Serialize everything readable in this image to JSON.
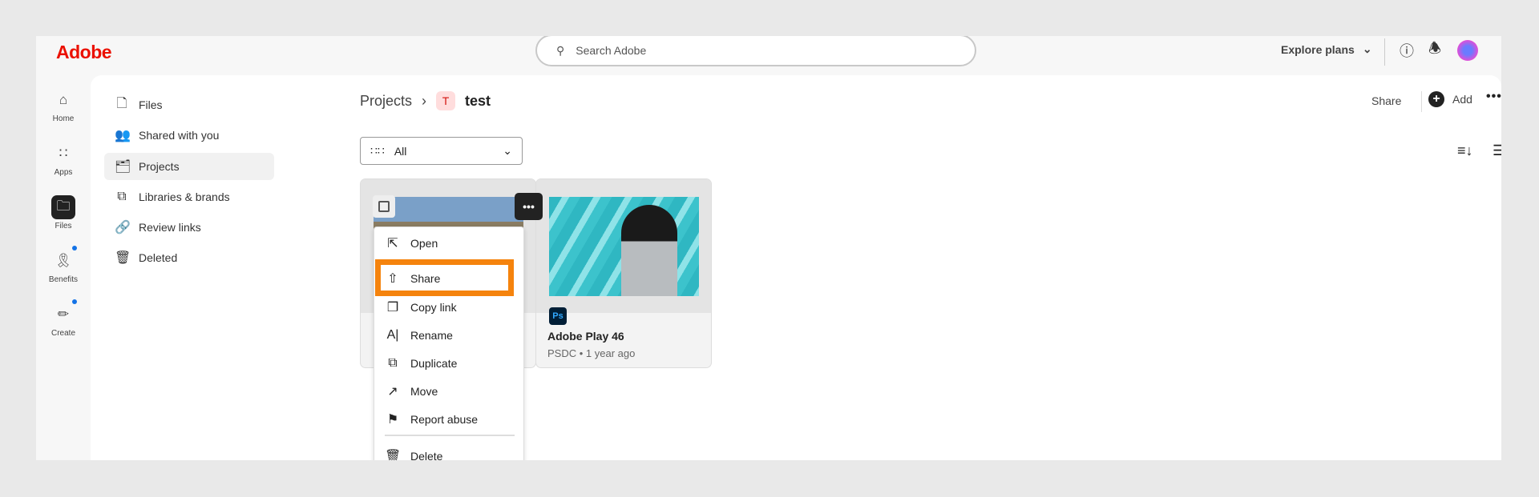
{
  "header": {
    "logo": "Adobe",
    "search_placeholder": "Search Adobe",
    "explore_plans": "Explore plans"
  },
  "rail": [
    {
      "label": "Home",
      "icon": "home-icon"
    },
    {
      "label": "Apps",
      "icon": "apps-icon"
    },
    {
      "label": "Files",
      "icon": "folder-icon",
      "active": true
    },
    {
      "label": "Benefits",
      "icon": "award-icon",
      "badge": true
    },
    {
      "label": "Create",
      "icon": "create-icon",
      "badge": true
    }
  ],
  "nav": [
    {
      "label": "Files"
    },
    {
      "label": "Shared with you"
    },
    {
      "label": "Projects",
      "active": true
    },
    {
      "label": "Libraries & brands"
    },
    {
      "label": "Review links"
    },
    {
      "label": "Deleted"
    }
  ],
  "breadcrumb": {
    "parent": "Projects",
    "badge": "T",
    "current": "test"
  },
  "filter": {
    "value": "All"
  },
  "page_actions": {
    "share": "Share",
    "add": "Add"
  },
  "cards": [
    {
      "title": "",
      "subtitle": ""
    },
    {
      "title": "Adobe Play 46",
      "subtitle": "PSDC • 1 year ago",
      "app_badge": "Ps"
    }
  ],
  "context_menu": [
    "Open",
    "Share",
    "Copy link",
    "Rename",
    "Duplicate",
    "Move",
    "Report abuse",
    "Delete"
  ],
  "highlight_color": "#f5830d"
}
